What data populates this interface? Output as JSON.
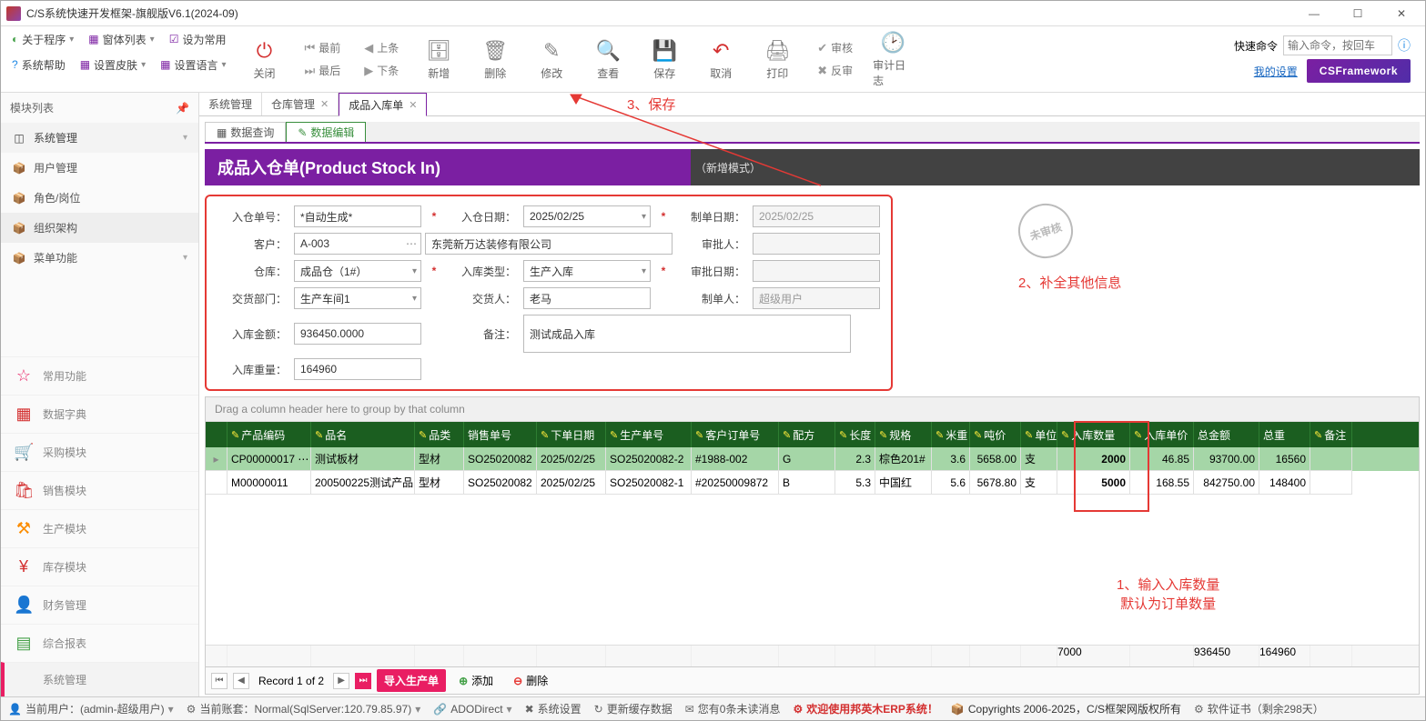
{
  "window": {
    "title": "C/S系统快速开发框架-旗舰版V6.1(2024-09)"
  },
  "menu1": {
    "about": "关于程序",
    "winlist": "窗体列表",
    "setdefault": "设为常用"
  },
  "menu2": {
    "syshelp": "系统帮助",
    "skin": "设置皮肤",
    "lang": "设置语言"
  },
  "ribbon": {
    "close": "关闭",
    "first": "最前",
    "last": "最后",
    "prev": "上条",
    "next": "下条",
    "new": "新增",
    "delete": "删除",
    "edit": "修改",
    "view": "查看",
    "save": "保存",
    "cancel": "取消",
    "print": "打印",
    "approve": "审核",
    "unapprove": "反审",
    "auditlog": "审计日志",
    "quickcmd_label": "快速命令",
    "quickcmd_ph": "输入命令，按回车",
    "mysettings": "我的设置",
    "csfw": "CSFramework"
  },
  "sidebar": {
    "title": "模块列表",
    "tree": [
      {
        "icon": "◫",
        "label": "系统管理",
        "hdr": true
      },
      {
        "icon": "📦",
        "label": "用户管理"
      },
      {
        "icon": "📦",
        "label": "角色/岗位"
      },
      {
        "icon": "📦",
        "label": "组织架构",
        "current": true
      },
      {
        "icon": "📦",
        "label": "菜单功能",
        "caret": true
      }
    ],
    "nav": [
      {
        "cls": "pink",
        "icon": "☆",
        "label": "常用功能"
      },
      {
        "cls": "red",
        "icon": "▦",
        "label": "数据字典"
      },
      {
        "cls": "teal",
        "icon": "🛒",
        "label": "采购模块"
      },
      {
        "cls": "red",
        "icon": "🛍",
        "label": "销售模块"
      },
      {
        "cls": "orange",
        "icon": "⚒",
        "label": "生产模块"
      },
      {
        "cls": "red",
        "icon": "¥",
        "label": "库存模块"
      },
      {
        "cls": "blue",
        "icon": "👤",
        "label": "财务管理"
      },
      {
        "cls": "green",
        "icon": "▤",
        "label": "综合报表"
      },
      {
        "cls": "gray sel",
        "icon": "</>",
        "label": "系统管理"
      }
    ]
  },
  "tabs": [
    {
      "label": "系统管理"
    },
    {
      "label": "仓库管理",
      "close": true
    },
    {
      "label": "成品入库单",
      "close": true,
      "active": true
    }
  ],
  "subtabs": [
    {
      "icon": "▦",
      "label": "数据查询"
    },
    {
      "icon": "✎",
      "label": "数据编辑",
      "active": true
    }
  ],
  "page": {
    "title": "成品入仓单(Product Stock In)",
    "mode": "（新增模式）"
  },
  "form": {
    "docno_label": "入仓单号：",
    "docno": "*自动生成*",
    "indate_label": "入仓日期：",
    "indate": "2025/02/25",
    "createdate_label": "制单日期：",
    "createdate": "2025/02/25",
    "cust_label": "客户：",
    "cust_code": "A-003",
    "cust_name": "东莞新万达装修有限公司",
    "approver_label": "审批人：",
    "approver": "",
    "wh_label": "仓库：",
    "wh": "成品仓（1#）",
    "intype_label": "入库类型：",
    "intype": "生产入库",
    "appdate_label": "审批日期：",
    "appdate": "",
    "dept_label": "交货部门：",
    "dept": "生产车间1",
    "deliverer_label": "交货人：",
    "deliverer": "老马",
    "creator_label": "制单人：",
    "creator": "超级用户",
    "amount_label": "入库金额：",
    "amount": "936450.0000",
    "note_label": "备注：",
    "note": "测试成品入库",
    "weight_label": "入库重量：",
    "weight": "164960",
    "stamp": "未审核"
  },
  "grid": {
    "grouphdr": "Drag a column header here to group by that column",
    "cols": [
      "产品编码",
      "品名",
      "品类",
      "销售单号",
      "下单日期",
      "生产单号",
      "客户订单号",
      "配方",
      "长度",
      "规格",
      "米重",
      "吨价",
      "单位",
      "入库数量",
      "入库单价",
      "总金额",
      "总重",
      "备注"
    ],
    "rows": [
      {
        "code": "CP00000017 ⋯",
        "name": "测试板材",
        "cat": "型材",
        "sale": "SO25020082",
        "ddate": "2025/02/25",
        "prod": "SO25020082-2",
        "cust": "#1988-002",
        "recipe": "G",
        "len": "2.3",
        "spec": "棕色201#",
        "mwt": "3.6",
        "twt": "5658.00",
        "unit": "支",
        "qty": "2000",
        "price": "46.85",
        "total": "93700.00",
        "gross": "16560",
        "note": ""
      },
      {
        "code": "M00000011",
        "name": "200500225测试产品",
        "cat": "型材",
        "sale": "SO25020082",
        "ddate": "2025/02/25",
        "prod": "SO25020082-1",
        "cust": "#20250009872",
        "recipe": "B",
        "len": "5.3",
        "spec": "中国红",
        "mwt": "5.6",
        "twt": "5678.80",
        "unit": "支",
        "qty": "5000",
        "price": "168.55",
        "total": "842750.00",
        "gross": "148400",
        "note": ""
      }
    ],
    "footer": {
      "qty": "7000",
      "total": "936450",
      "gross": "164960"
    },
    "nav": {
      "record": "Record 1 of 2",
      "import": "导入生产单",
      "add": "添加",
      "del": "删除"
    }
  },
  "annotations": {
    "a1": "1、输入入库数量\n默认为订单数量",
    "a2": "2、补全其他信息",
    "a3": "3、保存"
  },
  "status": {
    "user": "当前用户：(admin-超级用户)",
    "acct": "当前账套：Normal(SqlServer:120.79.85.97)",
    "ado": "ADODirect",
    "syscfg": "系统设置",
    "refresh": "更新缓存数据",
    "mail": "您有0条未读消息",
    "welcome": "欢迎使用邦英木ERP系统！",
    "copy": "Copyrights 2006-2025，C/S框架网版权所有",
    "cert": "软件证书（剩余298天）"
  }
}
